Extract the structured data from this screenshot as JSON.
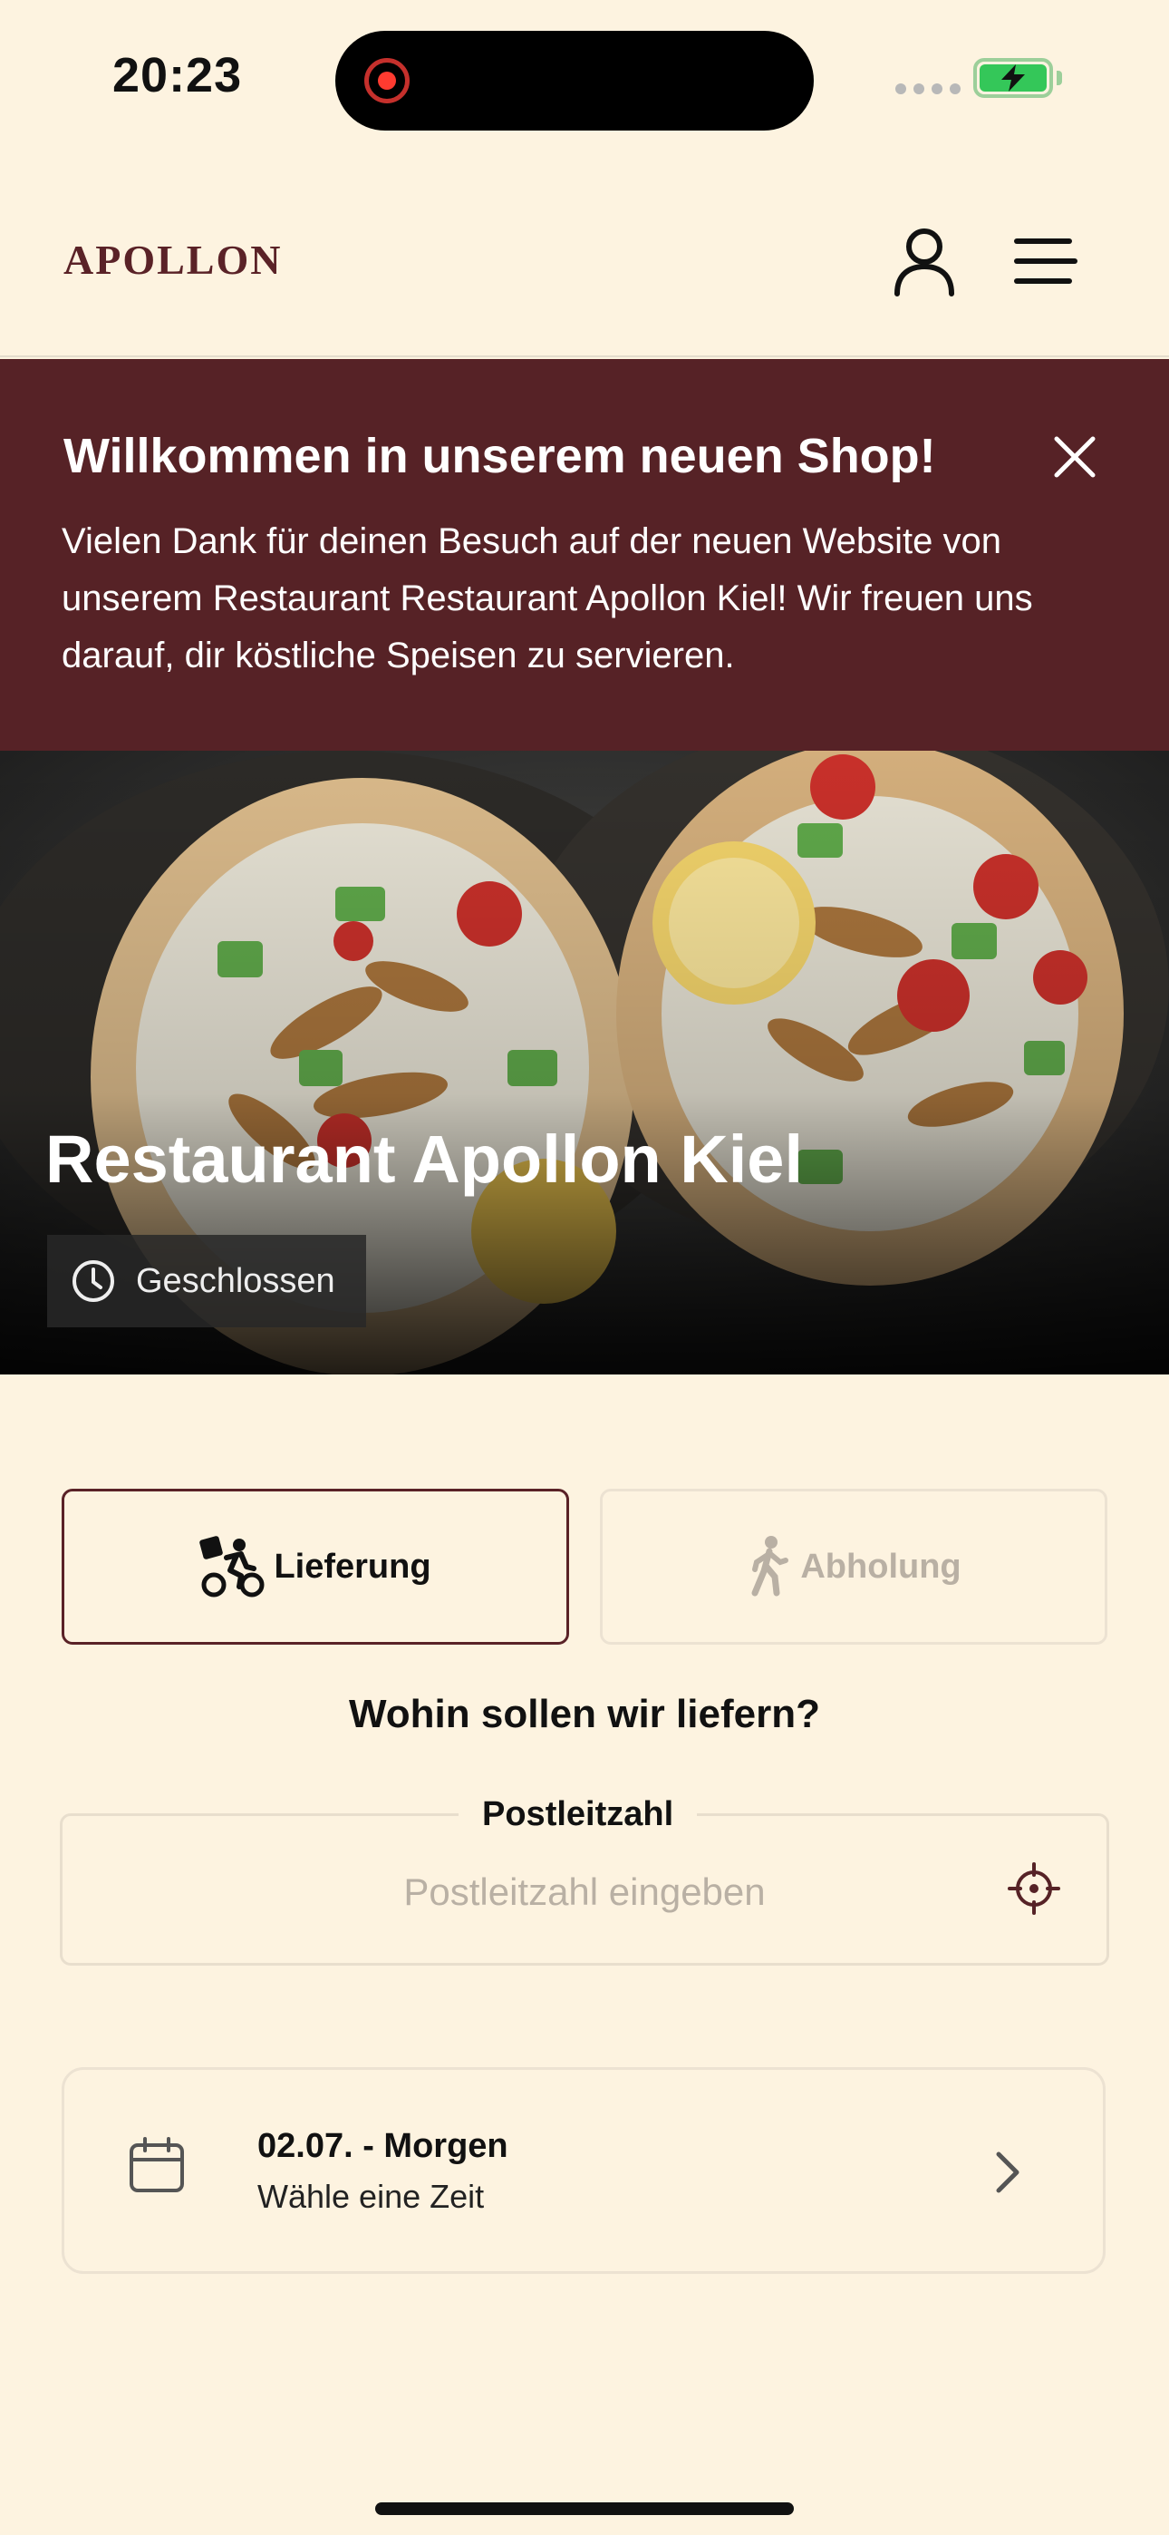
{
  "status_bar": {
    "time": "20:23"
  },
  "header": {
    "logo": "APOLLON"
  },
  "banner": {
    "title": "Willkommen in unserem neuen Shop!",
    "text": "Vielen Dank für deinen Besuch auf der neuen Website von unserem Restaurant Restaurant Apollon Kiel! Wir freuen uns darauf, dir köstliche Speisen zu servieren."
  },
  "hero": {
    "title": "Restaurant Apollon Kiel",
    "status": "Geschlossen"
  },
  "mode_tabs": {
    "delivery_label": "Lieferung",
    "pickup_label": "Abholung",
    "selected": "Lieferung"
  },
  "delivery": {
    "question": "Wohin sollen wir liefern?",
    "postcode_label": "Postleitzahl",
    "postcode_placeholder": "Postleitzahl eingeben",
    "postcode_value": ""
  },
  "schedule": {
    "date": "02.07. - Morgen",
    "time": "Wähle eine Zeit"
  },
  "colors": {
    "brand": "#562226",
    "background": "#fdf3e0",
    "battery": "#34c759",
    "recording": "#ff3b30"
  }
}
